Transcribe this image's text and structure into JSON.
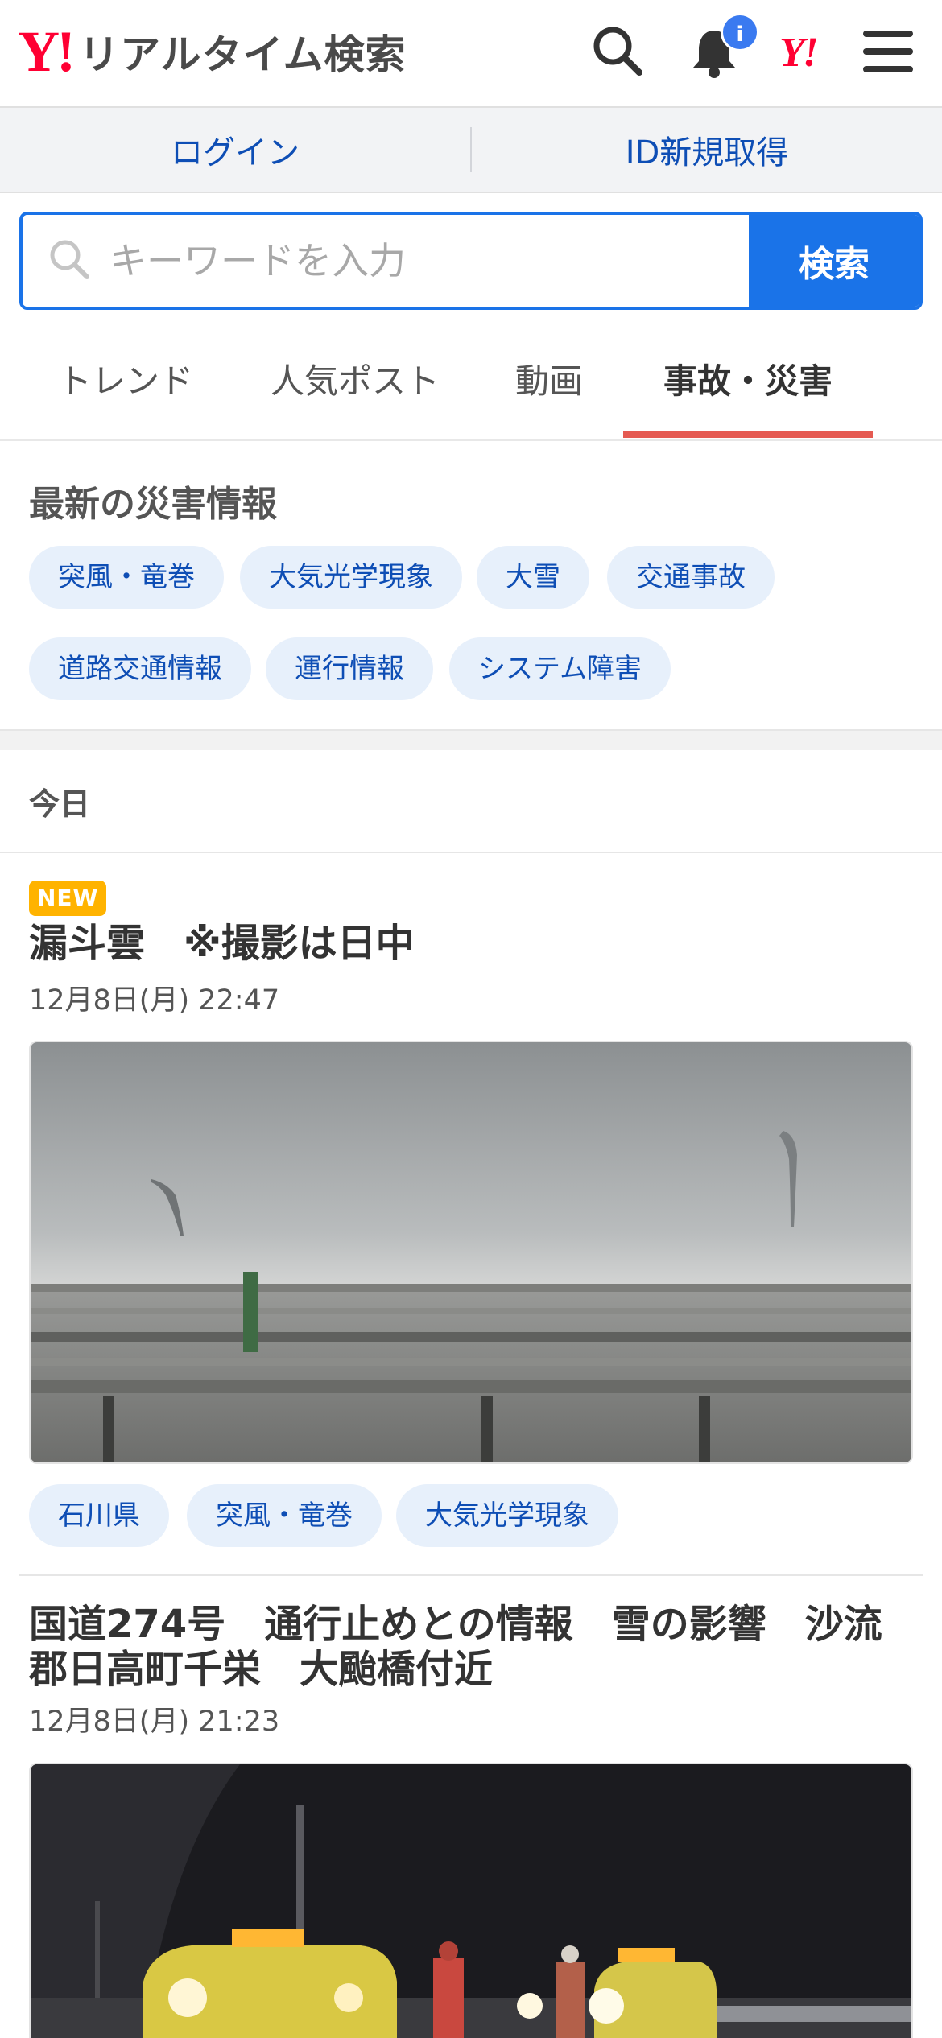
{
  "header": {
    "logo_mark": "Y!",
    "logo_text": "リアルタイム検索",
    "notification_badge": "i",
    "yahoo_mark": "Y!"
  },
  "auth": {
    "login": "ログイン",
    "register": "ID新規取得"
  },
  "search": {
    "placeholder": "キーワードを入力",
    "button": "検索"
  },
  "tabs": [
    {
      "label": "トレンド"
    },
    {
      "label": "人気ポスト"
    },
    {
      "label": "動画"
    },
    {
      "label": "事故・災害",
      "active": true
    }
  ],
  "disaster_info": {
    "title": "最新の災害情報",
    "chips": [
      "突風・竜巻",
      "大気光学現象",
      "大雪",
      "交通事故",
      "道路交通情報",
      "運行情報",
      "システム障害"
    ]
  },
  "feed": {
    "date_header": "今日",
    "posts": [
      {
        "badge": "NEW",
        "title": "漏斗雲　※撮影は日中",
        "datetime": "12月8日(月) 22:47",
        "tags": [
          "石川県",
          "突風・竜巻",
          "大気光学現象"
        ]
      },
      {
        "title_line1": "国道274号　通行止めとの情報　雪の影響　沙流",
        "title_line2": "郡日高町千栄　大颱橋付近",
        "datetime": "12月8日(月) 21:23"
      }
    ]
  },
  "colors": {
    "brand_red": "#ff0033",
    "accent_blue": "#1a73e8",
    "link_blue": "#0e4eb5",
    "tab_underline": "#e55a52",
    "chip_bg": "#e7f0fb",
    "new_badge": "#ffb300"
  }
}
